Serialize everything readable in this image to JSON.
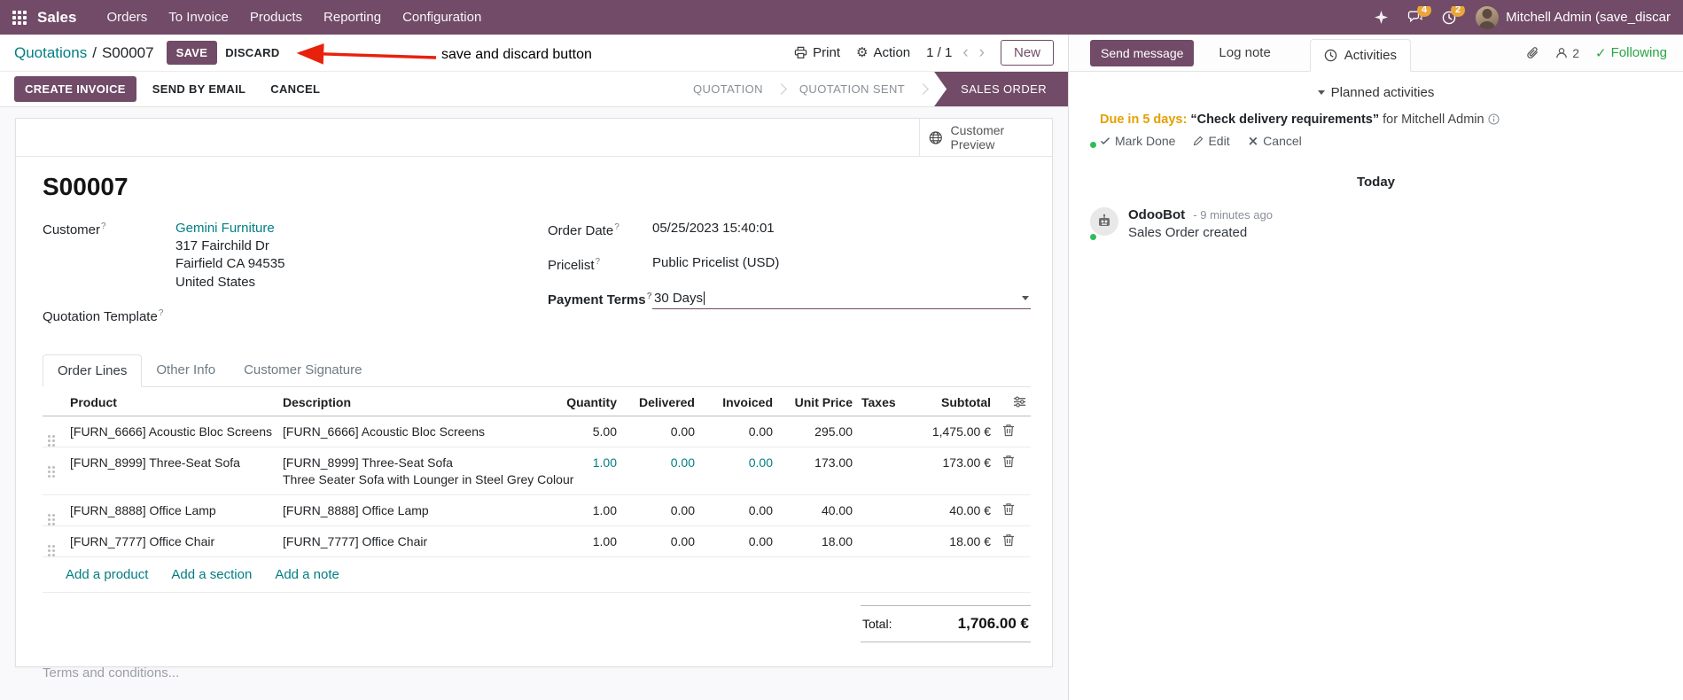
{
  "navbar": {
    "app_name": "Sales",
    "menu_items": [
      "Orders",
      "To Invoice",
      "Products",
      "Reporting",
      "Configuration"
    ],
    "messages_badge": "4",
    "activities_badge": "2",
    "user_name": "Mitchell Admin (save_discar"
  },
  "control_bar": {
    "breadcrumb_parent": "Quotations",
    "breadcrumb_separator": "/",
    "breadcrumb_current": "S00007",
    "save": "SAVE",
    "discard": "DISCARD",
    "print": "Print",
    "action": "Action",
    "pager": "1 / 1",
    "new": "New"
  },
  "annotation": {
    "text": "save and discard button",
    "arrow_color": "#e8210c"
  },
  "statusbar": {
    "create_invoice": "CREATE INVOICE",
    "send_by_email": "SEND BY EMAIL",
    "cancel": "CANCEL",
    "steps": [
      {
        "label": "QUOTATION",
        "active": false
      },
      {
        "label": "QUOTATION SENT",
        "active": false
      },
      {
        "label": "SALES ORDER",
        "active": true
      }
    ]
  },
  "sheet": {
    "preview_button": "Customer Preview",
    "title": "S00007",
    "help_marker": "?",
    "fields": {
      "customer_label": "Customer",
      "customer_name": "Gemini Furniture",
      "address_line1": "317 Fairchild Dr",
      "address_line2": "Fairfield CA 94535",
      "address_line3": "United States",
      "quotation_template_label": "Quotation Template",
      "order_date_label": "Order Date",
      "order_date_value": "05/25/2023 15:40:01",
      "pricelist_label": "Pricelist",
      "pricelist_value": "Public Pricelist (USD)",
      "payment_terms_label": "Payment Terms",
      "payment_terms_value": "30 Days"
    },
    "tabs": [
      {
        "label": "Order Lines",
        "active": true
      },
      {
        "label": "Other Info",
        "active": false
      },
      {
        "label": "Customer Signature",
        "active": false
      }
    ],
    "order_lines": {
      "columns": {
        "product": "Product",
        "description": "Description",
        "quantity": "Quantity",
        "delivered": "Delivered",
        "invoiced": "Invoiced",
        "unit_price": "Unit Price",
        "taxes": "Taxes",
        "subtotal": "Subtotal"
      },
      "rows": [
        {
          "product": "[FURN_6666] Acoustic Bloc Screens",
          "description": "[FURN_6666] Acoustic Bloc Screens",
          "description2": "",
          "quantity": "5.00",
          "delivered": "0.00",
          "invoiced": "0.00",
          "unit_price": "295.00",
          "taxes": "",
          "subtotal": "1,475.00 €"
        },
        {
          "product": "[FURN_8999] Three-Seat Sofa",
          "description": "[FURN_8999] Three-Seat Sofa",
          "description2": "Three Seater Sofa with Lounger in Steel Grey Colour",
          "quantity": "1.00",
          "delivered": "0.00",
          "invoiced": "0.00",
          "unit_price": "173.00",
          "taxes": "",
          "subtotal": "173.00 €"
        },
        {
          "product": "[FURN_8888] Office Lamp",
          "description": "[FURN_8888] Office Lamp",
          "description2": "",
          "quantity": "1.00",
          "delivered": "0.00",
          "invoiced": "0.00",
          "unit_price": "40.00",
          "taxes": "",
          "subtotal": "40.00 €"
        },
        {
          "product": "[FURN_7777] Office Chair",
          "description": "[FURN_7777] Office Chair",
          "description2": "",
          "quantity": "1.00",
          "delivered": "0.00",
          "invoiced": "0.00",
          "unit_price": "18.00",
          "taxes": "",
          "subtotal": "18.00 €"
        }
      ],
      "add_product": "Add a product",
      "add_section": "Add a section",
      "add_note": "Add a note",
      "total_label": "Total:",
      "total_value": "1,706.00 €"
    },
    "terms_placeholder": "Terms and conditions..."
  },
  "chatter": {
    "send_message": "Send message",
    "log_note": "Log note",
    "activities_tab": "Activities",
    "followers_count": "2",
    "following": "Following",
    "planned_activities_header": "Planned activities",
    "activity": {
      "due": "Due in 5 days:",
      "summary": "“Check delivery requirements”",
      "assignee": "for Mitchell Admin",
      "mark_done": "Mark Done",
      "edit": "Edit",
      "cancel": "Cancel"
    },
    "date_separator": "Today",
    "message": {
      "author": "OdooBot",
      "time": "- 9 minutes ago",
      "body": "Sales Order created"
    }
  },
  "colors": {
    "primary": "#714B67",
    "link_teal": "#017e84",
    "due_orange": "#e4a000",
    "following_green": "#28a745",
    "annotation_red": "#e8210c",
    "badge_orange": "#e9a63a"
  }
}
